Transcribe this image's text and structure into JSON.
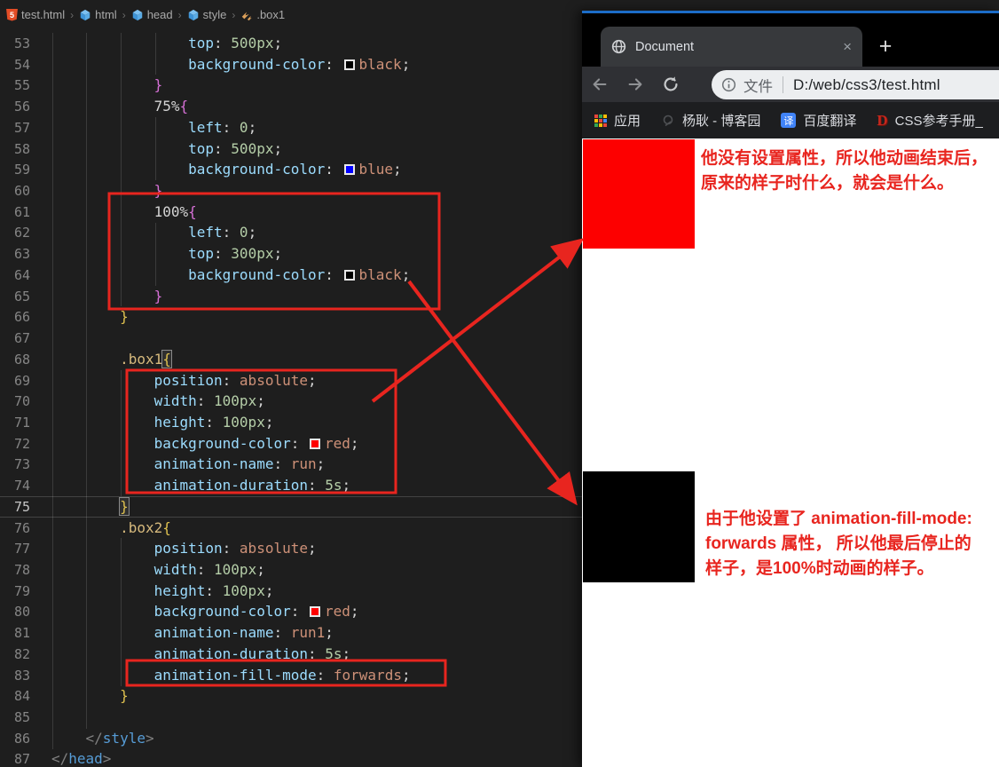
{
  "colors": {
    "annotation_red": "#e8251f",
    "page_box_red": "#fd0000",
    "page_box_black": "#000000",
    "window_accent_blue": "#1c6cc7",
    "editor_background": "#1e1e1e"
  },
  "editor": {
    "breadcrumb": {
      "file": "test.html",
      "path": [
        "html",
        "head",
        "style"
      ],
      "symbol": ".box1",
      "sep": "›"
    },
    "lines": [
      {
        "n": "53",
        "ind": 16,
        "segs": [
          [
            "p",
            "top"
          ],
          [
            "u",
            ": "
          ],
          [
            "n",
            "500px"
          ],
          [
            "u",
            ";"
          ]
        ]
      },
      {
        "n": "54",
        "ind": 16,
        "segs": [
          [
            "p",
            "background-color"
          ],
          [
            "u",
            ": "
          ],
          [
            "sw",
            "#000000"
          ],
          [
            "v",
            "black"
          ],
          [
            "u",
            ";"
          ]
        ]
      },
      {
        "n": "55",
        "ind": 12,
        "segs": [
          [
            "bp",
            "}"
          ]
        ]
      },
      {
        "n": "56",
        "ind": 12,
        "segs": [
          [
            "pct",
            "75%"
          ],
          [
            "bp",
            "{"
          ]
        ]
      },
      {
        "n": "57",
        "ind": 16,
        "segs": [
          [
            "p",
            "left"
          ],
          [
            "u",
            ": "
          ],
          [
            "n",
            "0"
          ],
          [
            "u",
            ";"
          ]
        ]
      },
      {
        "n": "58",
        "ind": 16,
        "segs": [
          [
            "p",
            "top"
          ],
          [
            "u",
            ": "
          ],
          [
            "n",
            "500px"
          ],
          [
            "u",
            ";"
          ]
        ]
      },
      {
        "n": "59",
        "ind": 16,
        "segs": [
          [
            "p",
            "background-color"
          ],
          [
            "u",
            ": "
          ],
          [
            "sw",
            "#0000ff"
          ],
          [
            "v",
            "blue"
          ],
          [
            "u",
            ";"
          ]
        ]
      },
      {
        "n": "60",
        "ind": 12,
        "segs": [
          [
            "bp",
            "}"
          ]
        ]
      },
      {
        "n": "61",
        "ind": 12,
        "segs": [
          [
            "pct",
            "100%"
          ],
          [
            "bp",
            "{"
          ]
        ]
      },
      {
        "n": "62",
        "ind": 16,
        "segs": [
          [
            "p",
            "left"
          ],
          [
            "u",
            ": "
          ],
          [
            "n",
            "0"
          ],
          [
            "u",
            ";"
          ]
        ]
      },
      {
        "n": "63",
        "ind": 16,
        "segs": [
          [
            "p",
            "top"
          ],
          [
            "u",
            ": "
          ],
          [
            "n",
            "300px"
          ],
          [
            "u",
            ";"
          ]
        ]
      },
      {
        "n": "64",
        "ind": 16,
        "segs": [
          [
            "p",
            "background-color"
          ],
          [
            "u",
            ": "
          ],
          [
            "sw",
            "#000000"
          ],
          [
            "v",
            "black"
          ],
          [
            "u",
            ";"
          ]
        ]
      },
      {
        "n": "65",
        "ind": 12,
        "segs": [
          [
            "bp",
            "}"
          ]
        ]
      },
      {
        "n": "66",
        "ind": 8,
        "segs": [
          [
            "bg",
            "}"
          ]
        ]
      },
      {
        "n": "67",
        "ind": 0,
        "segs": []
      },
      {
        "n": "68",
        "ind": 8,
        "segs": [
          [
            "sel",
            ".box1"
          ],
          [
            "bgm",
            "{"
          ]
        ]
      },
      {
        "n": "69",
        "ind": 12,
        "segs": [
          [
            "p",
            "position"
          ],
          [
            "u",
            ": "
          ],
          [
            "v",
            "absolute"
          ],
          [
            "u",
            ";"
          ]
        ]
      },
      {
        "n": "70",
        "ind": 12,
        "segs": [
          [
            "p",
            "width"
          ],
          [
            "u",
            ": "
          ],
          [
            "n",
            "100px"
          ],
          [
            "u",
            ";"
          ]
        ]
      },
      {
        "n": "71",
        "ind": 12,
        "segs": [
          [
            "p",
            "height"
          ],
          [
            "u",
            ": "
          ],
          [
            "n",
            "100px"
          ],
          [
            "u",
            ";"
          ]
        ]
      },
      {
        "n": "72",
        "ind": 12,
        "segs": [
          [
            "p",
            "background-color"
          ],
          [
            "u",
            ": "
          ],
          [
            "sw",
            "#ff0000"
          ],
          [
            "v",
            "red"
          ],
          [
            "u",
            ";"
          ]
        ]
      },
      {
        "n": "73",
        "ind": 12,
        "segs": [
          [
            "p",
            "animation-name"
          ],
          [
            "u",
            ": "
          ],
          [
            "v",
            "run"
          ],
          [
            "u",
            ";"
          ]
        ]
      },
      {
        "n": "74",
        "ind": 12,
        "segs": [
          [
            "p",
            "animation-duration"
          ],
          [
            "u",
            ": "
          ],
          [
            "n",
            "5s"
          ],
          [
            "u",
            ";"
          ]
        ]
      },
      {
        "n": "75",
        "ind": 8,
        "cur": true,
        "segs": [
          [
            "bgm",
            "}"
          ]
        ]
      },
      {
        "n": "76",
        "ind": 8,
        "segs": [
          [
            "sel",
            ".box2"
          ],
          [
            "bg",
            "{"
          ]
        ]
      },
      {
        "n": "77",
        "ind": 12,
        "segs": [
          [
            "p",
            "position"
          ],
          [
            "u",
            ": "
          ],
          [
            "v",
            "absolute"
          ],
          [
            "u",
            ";"
          ]
        ]
      },
      {
        "n": "78",
        "ind": 12,
        "segs": [
          [
            "p",
            "width"
          ],
          [
            "u",
            ": "
          ],
          [
            "n",
            "100px"
          ],
          [
            "u",
            ";"
          ]
        ]
      },
      {
        "n": "79",
        "ind": 12,
        "segs": [
          [
            "p",
            "height"
          ],
          [
            "u",
            ": "
          ],
          [
            "n",
            "100px"
          ],
          [
            "u",
            ";"
          ]
        ]
      },
      {
        "n": "80",
        "ind": 12,
        "segs": [
          [
            "p",
            "background-color"
          ],
          [
            "u",
            ": "
          ],
          [
            "sw",
            "#ff0000"
          ],
          [
            "v",
            "red"
          ],
          [
            "u",
            ";"
          ]
        ]
      },
      {
        "n": "81",
        "ind": 12,
        "segs": [
          [
            "p",
            "animation-name"
          ],
          [
            "u",
            ": "
          ],
          [
            "v",
            "run1"
          ],
          [
            "u",
            ";"
          ]
        ]
      },
      {
        "n": "82",
        "ind": 12,
        "segs": [
          [
            "p",
            "animation-duration"
          ],
          [
            "u",
            ": "
          ],
          [
            "n",
            "5s"
          ],
          [
            "u",
            ";"
          ]
        ]
      },
      {
        "n": "83",
        "ind": 12,
        "segs": [
          [
            "p",
            "animation-fill-mode"
          ],
          [
            "u",
            ": "
          ],
          [
            "v",
            "forwards"
          ],
          [
            "u",
            ";"
          ]
        ]
      },
      {
        "n": "84",
        "ind": 8,
        "segs": [
          [
            "bg",
            "}"
          ]
        ]
      },
      {
        "n": "85",
        "ind": 0,
        "segs": []
      },
      {
        "n": "86",
        "ind": 4,
        "segs": [
          [
            "tp",
            "</"
          ],
          [
            "tg",
            "style"
          ],
          [
            "tp",
            ">"
          ]
        ]
      },
      {
        "n": "87",
        "ind": 0,
        "segs": [
          [
            "tp",
            "</"
          ],
          [
            "tg",
            "head"
          ],
          [
            "tp",
            ">"
          ]
        ]
      }
    ]
  },
  "browser": {
    "tab": {
      "title": "Document",
      "close_glyph": "×",
      "new_tab_glyph": "+"
    },
    "address": {
      "prefix": "文件",
      "url": "D:/web/css3/test.html"
    },
    "bookmarks": [
      {
        "label": "应用",
        "icon": "apps-grid-icon"
      },
      {
        "label": "杨耿 - 博客园",
        "icon": "faded-logo-icon"
      },
      {
        "label": "百度翻译",
        "icon": "translate-icon",
        "icon_text": "译"
      },
      {
        "label": "CSS参考手册_",
        "icon": "d-logo-icon",
        "icon_text": "D"
      }
    ]
  },
  "annotations": {
    "note1": [
      "他没有设置属性，所以他动画结束后，",
      "原来的样子时什么，就会是什么。"
    ],
    "note2": [
      "由于他设置了 animation-fill-mode:",
      "forwards 属性， 所以他最后停止的",
      "样子，是100%时动画的样子。"
    ]
  }
}
